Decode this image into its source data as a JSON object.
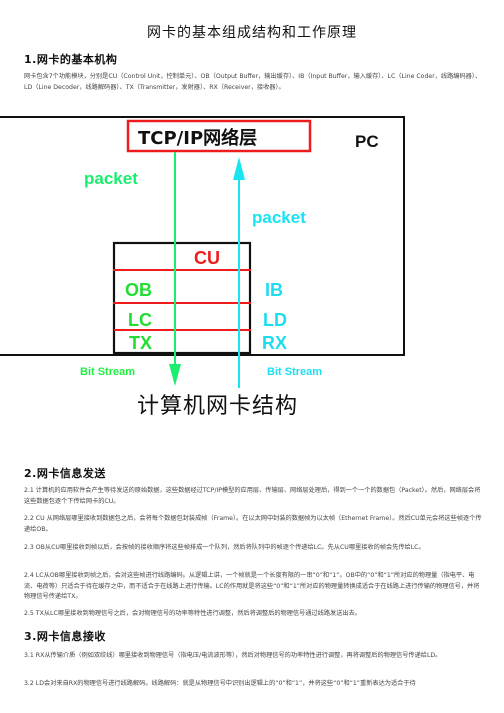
{
  "title": "网卡的基本组成结构和工作原理",
  "sections": [
    {
      "heading": "1.网卡的基本机构",
      "paragraphs": [
        "网卡包含7个功能模块，分别是CU（Control Unit，控制单元）、OB（Output Buffer，输出缓存）、IB（Input Buffer，输入缓存）、LC（Line Coder，线路编码器）、LD（Line Decoder，线路解码器）、TX（Transmitter，发射器）、RX（Receiver，接收器）。"
      ]
    },
    {
      "heading": "2.网卡信息发送",
      "paragraphs": [
        "2.1 计算机的应用软件会产生等待发送的原始数据，这些数据经过TCP/IP模型的应用层、传输层、网络层处理后，得到一个一个的数据包（Packet）。然后，网络层会将这些数据包逐个下传给网卡的CU。",
        "2.2 CU 从网络层哪里接收到数据包之后，会将每个数据包封装成帧（Frame）。在以太网中封装的数据帧为以太帧（Ethernet Frame）。然后CU单元会将这些帧逐个传递给OB。",
        "2.3 OB从CU哪里接收到帧以后，会按帧的接收顺序将这些帧排成一个队列，然后将队列中的帧逐个传递给LC。先从CU哪里接收的帧会先传给LC。",
        "2.4 LC从OB哪里接收到帧之后，会对这些帧进行线路编码。从逻辑上讲，一个帧就是一个长度有限的一串“0”和“1”。OB中的“0”和“1”所对应的物理量（指电平、电流、电荷等）只适合于待在缓存之中，而不适合于在线路上进行传输。LC的作用就是将这些“0”和“1”所对应的物理量转换成适合于在线路上进行传输的物理信号，并将物理信号传递给TX。",
        "2.5 TX从LC哪里接收到物理信号之后，会对物理信号的功率等特性进行调整，然后将调整后的物理信号通过线路发送出去。"
      ]
    },
    {
      "heading": "3.网卡信息接收",
      "paragraphs": [
        "3.1 RX从传输介质（例如双绞线）哪里接收到物理信号（指电压/电流波形等），然后对物理信号的功率特性进行调整，再将调整后的物理信号传递给LD。",
        "3.2 LD会对来自RX的物理信号进行线路解码。线路解码：就是从物理信号中识别出逻辑上的“0”和“1”，并将这些“0”和“1”重新表达为适合于待"
      ]
    }
  ],
  "diagram": {
    "pc_label": "PC",
    "network_layer_label": "TCP/IP网络层",
    "packet_down_label": "packet",
    "packet_up_label": "packet",
    "modules": {
      "cu": "CU",
      "ob": "OB",
      "ib": "IB",
      "lc": "LC",
      "ld": "LD",
      "tx": "TX",
      "rx": "RX"
    },
    "bitstream_out_label": "Bit Stream",
    "bitstream_in_label": "Bit Stream",
    "caption": "计算机网卡结构",
    "colors": {
      "send": "#19ee6e",
      "receive": "#18e4f2",
      "divider": "#ee1c1c",
      "module_send": "#22dd33",
      "module_receive": "#1fdcf0",
      "frame": "#111111"
    }
  }
}
